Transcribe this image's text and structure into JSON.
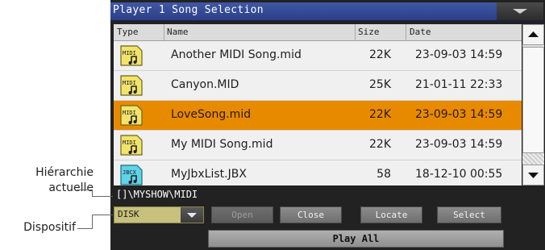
{
  "window": {
    "title": "Player 1 Song Selection"
  },
  "columns": {
    "type": "Type",
    "name": "Name",
    "size": "Size",
    "date": "Date"
  },
  "files": [
    {
      "icon": "midi-file-icon",
      "name": "Another MIDI Song.mid",
      "size": "22K",
      "date": "23-09-03 14:59",
      "selected": false
    },
    {
      "icon": "midi-file-icon",
      "name": "Canyon.MID",
      "size": "25K",
      "date": "21-01-11 22:33",
      "selected": false
    },
    {
      "icon": "midi-file-icon",
      "name": "LoveSong.mid",
      "size": "22K",
      "date": "23-09-03 14:59",
      "selected": true
    },
    {
      "icon": "midi-file-icon",
      "name": "My MIDI Song.mid",
      "size": "22K",
      "date": "23-09-03 14:59",
      "selected": false
    },
    {
      "icon": "jbx-file-icon",
      "name": "MyJbxList.JBX",
      "size": "58",
      "date": "18-12-10 00:55",
      "selected": false
    }
  ],
  "path": "[]\\MYSHOW\\MIDI",
  "device": {
    "value": "DISK"
  },
  "buttons": {
    "open": "Open",
    "close": "Close",
    "locate": "Locate",
    "select": "Select",
    "play_all": "Play All"
  },
  "callouts": {
    "hierarchy_line1": "Hiérarchie",
    "hierarchy_line2": "actuelle",
    "device": "Dispositif"
  },
  "colors": {
    "selected_row": "#e88a00",
    "title_bar": "#3f57a6",
    "midi_icon": "#f2e36b",
    "jbx_icon": "#5fd3e8"
  }
}
